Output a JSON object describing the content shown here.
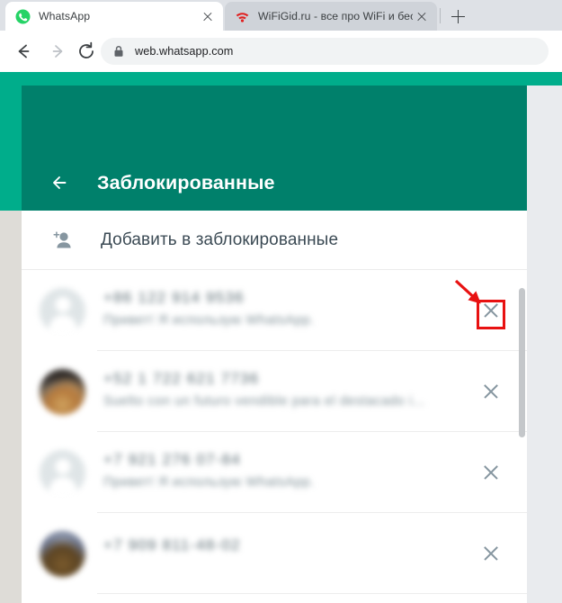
{
  "browser": {
    "tabs": [
      {
        "title": "WhatsApp",
        "favicon": "whatsapp-icon",
        "active": true
      },
      {
        "title": "WiFiGid.ru - все про WiFi и бесп",
        "favicon": "wifi-icon",
        "active": false
      }
    ],
    "new_tab_label": "+",
    "nav": {
      "back": "back-arrow-icon",
      "forward": "forward-arrow-icon",
      "reload": "reload-icon"
    },
    "omnibox": {
      "url": "web.whatsapp.com",
      "security": "lock-icon"
    }
  },
  "app": {
    "header": {
      "back_label": "back-arrow-icon",
      "title": "Заблокированные",
      "bg_color": "#00806b",
      "band_color": "#00ad8b"
    },
    "add_row": {
      "icon": "person-add-icon",
      "label": "Добавить в заблокированные"
    },
    "blocked_contacts": [
      {
        "name": "+86 122 914 9536",
        "status": "Привет! Я использую WhatsApp.",
        "avatar": "default",
        "unblock_label": "unblock-x-icon",
        "highlighted": true
      },
      {
        "name": "+52 1 722 621 7736",
        "status": "Suelto con un futuro vendible para el destacado i...",
        "avatar": "photo-a",
        "unblock_label": "unblock-x-icon",
        "highlighted": false
      },
      {
        "name": "+7 921 276 07-84",
        "status": "Привет! Я использую WhatsApp.",
        "avatar": "default",
        "unblock_label": "unblock-x-icon",
        "highlighted": false
      },
      {
        "name": "+7 909 811-48-02",
        "status": "",
        "avatar": "photo-b",
        "unblock_label": "unblock-x-icon",
        "highlighted": false
      }
    ],
    "scrollbar": {
      "thumb_color": "#c4c7ca"
    }
  },
  "annotation": {
    "arrow_color": "#e81111",
    "box_color": "#e81111",
    "target": "unblock-x-icon-row-1"
  }
}
